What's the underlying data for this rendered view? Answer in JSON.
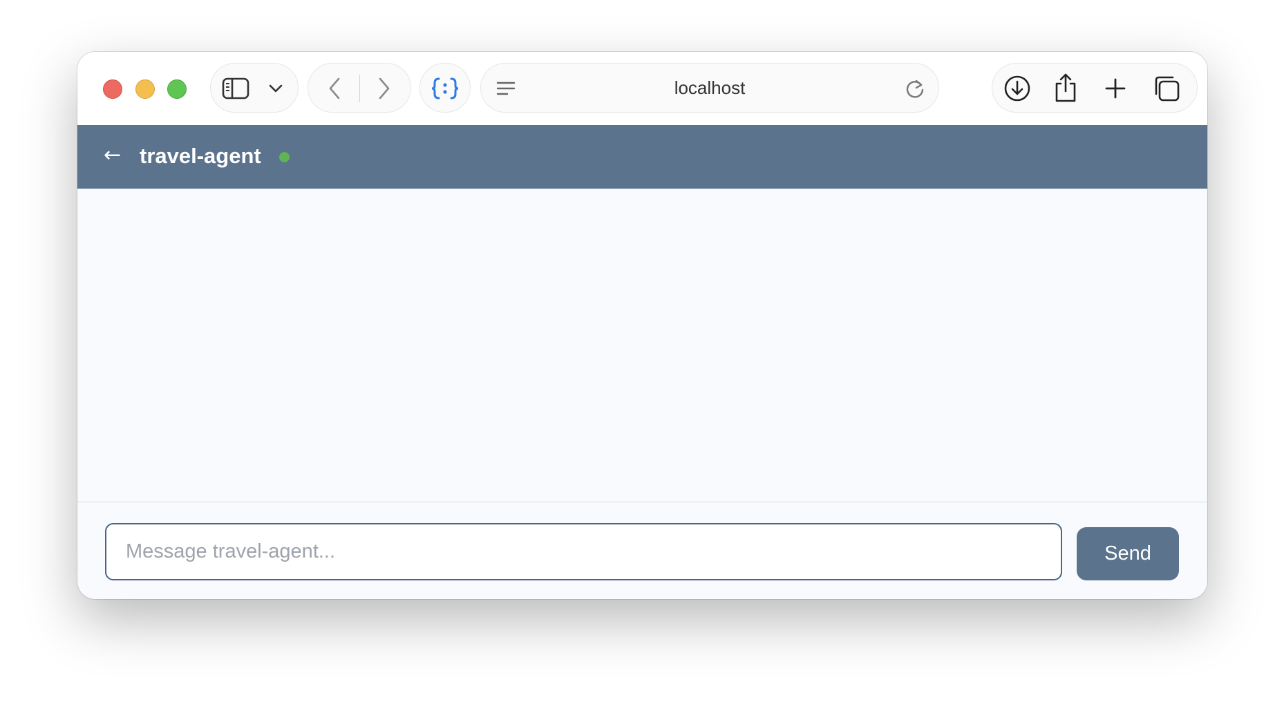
{
  "browser": {
    "url": "localhost",
    "icons": {
      "sidebar": "sidebar-icon",
      "sidebar_menu": "chevron-down-icon",
      "back": "chevron-left-icon",
      "forward": "chevron-right-icon",
      "extension": "braces-icon",
      "reader": "reader-lines-icon",
      "reload": "reload-icon",
      "download": "download-icon",
      "share": "share-icon",
      "new_tab": "plus-icon",
      "tabs": "tabs-overview-icon"
    }
  },
  "app": {
    "header": {
      "back_glyph": "←",
      "title": "travel-agent",
      "status_color": "#5eb552",
      "background": "#5b738d"
    },
    "composer": {
      "placeholder": "Message travel-agent...",
      "value": "",
      "send_label": "Send"
    }
  }
}
